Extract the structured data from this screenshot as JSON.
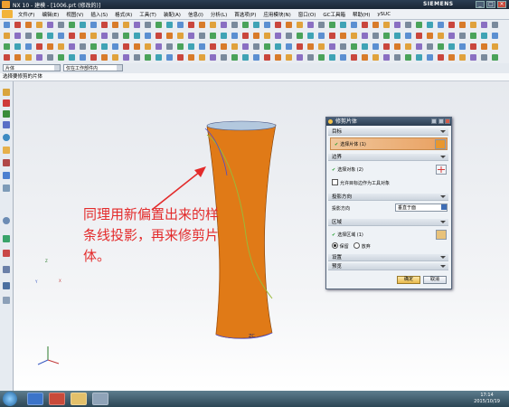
{
  "window": {
    "title": "NX 10 - 建模 - [1006.prt (修改的)]",
    "brand": "SIEMENS"
  },
  "menu": [
    "文件(F)",
    "编辑(E)",
    "视图(V)",
    "插入(S)",
    "格式(R)",
    "工具(T)",
    "装配(A)",
    "信息(I)",
    "分析(L)",
    "首选项(P)",
    "应用模块(N)",
    "窗口(O)",
    "GC工具箱",
    "帮助(H)",
    "ySUC"
  ],
  "selection": {
    "filter": "片体",
    "scope": "仅在工作部件内"
  },
  "cue": "选择要修剪的片体",
  "dialog": {
    "title": "修剪片体",
    "sections": {
      "target": {
        "label": "目标",
        "item": "选择片体 (1)"
      },
      "boundary": {
        "label": "边界",
        "item": "选择对象 (2)",
        "checkbox": "允许目标边作为工具对象"
      },
      "projection": {
        "label": "投影方向",
        "field_label": "投影方向",
        "value": "垂直于面"
      },
      "region": {
        "label": "区域",
        "item": "选择区域 (1)",
        "opt1": "保留",
        "opt2": "放弃"
      },
      "settings": {
        "label": "设置"
      },
      "preview": {
        "label": "预览"
      }
    },
    "ok": "确定",
    "cancel": "取消"
  },
  "annotation": "同理用新偏置出来的样条线投影，再来修剪片体。",
  "viewport_label": "ZC",
  "triad": {
    "x": "X",
    "y": "Y",
    "z": "Z"
  },
  "clock": {
    "time": "17:14",
    "date": "2015/10/19"
  },
  "colors": {
    "sheet": "#e07a17",
    "accent_red": "#e32b2b",
    "curve": "#9ab93a"
  }
}
